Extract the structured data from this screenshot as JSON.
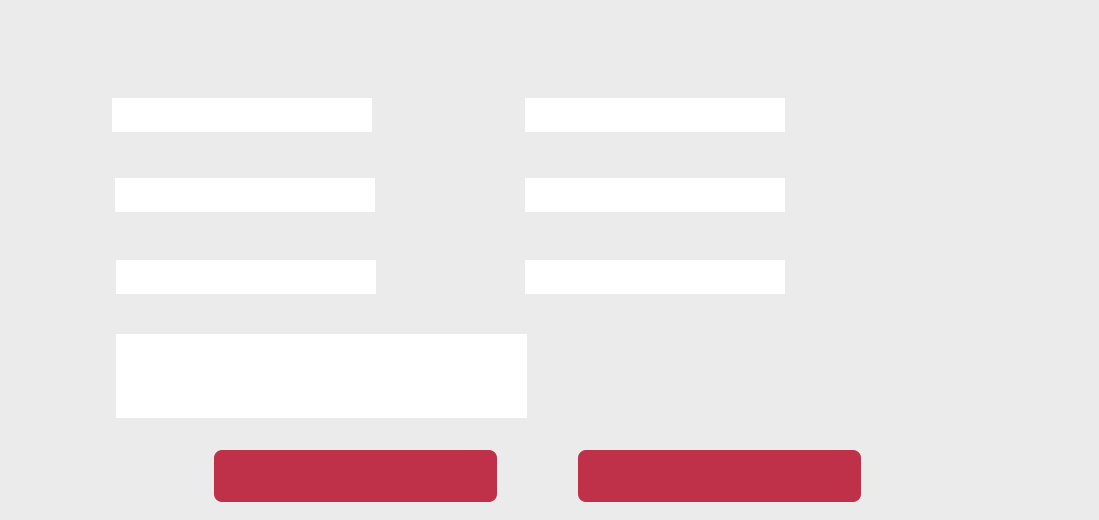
{
  "form": {
    "fields": [
      {
        "value": "",
        "placeholder": ""
      },
      {
        "value": "",
        "placeholder": ""
      },
      {
        "value": "",
        "placeholder": ""
      },
      {
        "value": "",
        "placeholder": ""
      },
      {
        "value": "",
        "placeholder": ""
      },
      {
        "value": "",
        "placeholder": ""
      }
    ],
    "message": {
      "value": "",
      "placeholder": ""
    },
    "buttons": {
      "left_label": "",
      "right_label": ""
    }
  },
  "colors": {
    "background": "#ebebeb",
    "field": "#ffffff",
    "button": "#bf3049"
  }
}
